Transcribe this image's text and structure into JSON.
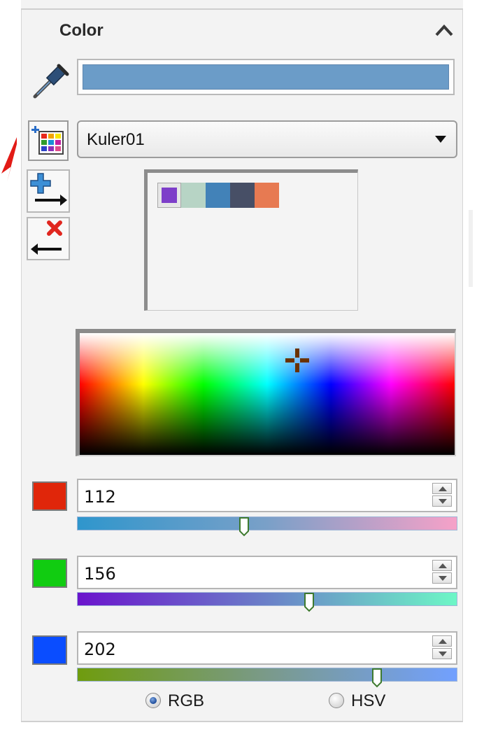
{
  "panel": {
    "title": "Color",
    "collapse_icon": "chevron-up-icon"
  },
  "current_color": {
    "hex": "#6b9cc8",
    "picker_icon": "eyedropper-icon"
  },
  "palette": {
    "selected": "Kuler01",
    "button_icon": "palette-grid-icon",
    "add_icon": "add-to-palette-icon",
    "remove_icon": "remove-from-palette-icon",
    "swatches": [
      {
        "color": "#7d3ec9",
        "selected": true
      },
      {
        "color": "#b7d4c5"
      },
      {
        "color": "#4282b8"
      },
      {
        "color": "#474f66"
      },
      {
        "color": "#e77a52"
      }
    ]
  },
  "channels": [
    {
      "name": "red",
      "swatch_color": "#e0260a",
      "value": "112",
      "bar_from": "#2f96cc",
      "bar_mid": "#7aa0c8",
      "bar_to": "#f6a1c8",
      "level": 0.44
    },
    {
      "name": "green",
      "swatch_color": "#11cc11",
      "value": "156",
      "bar_from": "#6a13cc",
      "bar_mid": "#6a80c8",
      "bar_to": "#6df7c6",
      "level": 0.61
    },
    {
      "name": "blue",
      "swatch_color": "#0a4dff",
      "value": "202",
      "bar_from": "#6f9c0e",
      "bar_mid": "#7a9a8a",
      "bar_to": "#72a0ff",
      "level": 0.79
    }
  ],
  "mode": {
    "options": [
      "RGB",
      "HSV"
    ],
    "selected": "RGB"
  }
}
